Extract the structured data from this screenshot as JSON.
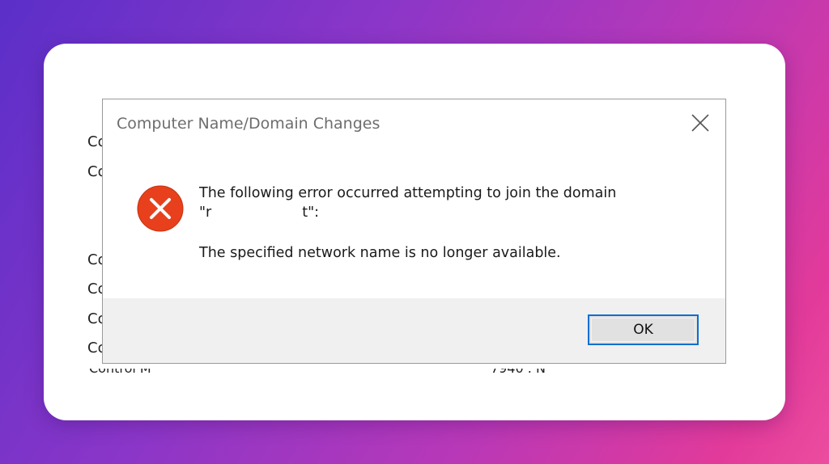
{
  "background_window": {
    "row_fragments": [
      "Co",
      "Co",
      "Co",
      "Co",
      "Co",
      "Co"
    ],
    "bottom_left_fragment": "Control M",
    "bottom_right_fragment": "7940 . N"
  },
  "dialog": {
    "title": "Computer Name/Domain Changes",
    "close_icon": "close-x-icon",
    "error_icon": "error-circle-x-icon",
    "message": {
      "line1": "The following error occurred attempting to join the domain",
      "line2_prefix": "\"r",
      "line2_suffix": "t\":",
      "line3": "The specified network name is no longer available."
    },
    "ok_label": "OK"
  },
  "colors": {
    "error_red": "#e8401c",
    "button_focus": "#0a6fd1",
    "footer_bg": "#f0f0f0",
    "title_gray": "#6d6d6d"
  }
}
